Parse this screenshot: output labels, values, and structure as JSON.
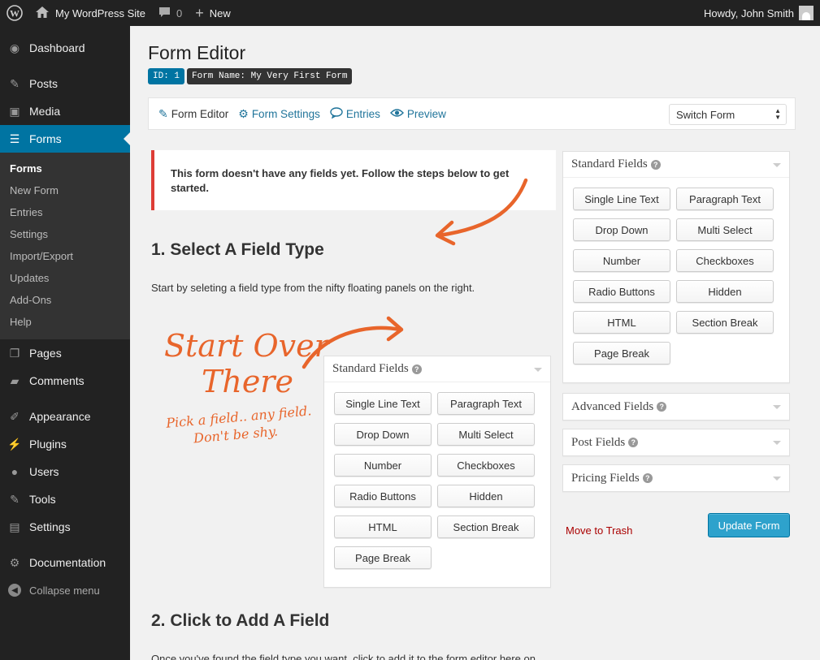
{
  "adminbar": {
    "site_name": "My WordPress Site",
    "comments_count": "0",
    "new_label": "New",
    "greeting": "Howdy, John Smith"
  },
  "sidebar": {
    "dashboard": "Dashboard",
    "posts": "Posts",
    "media": "Media",
    "forms": "Forms",
    "forms_sub": [
      "Forms",
      "New Form",
      "Entries",
      "Settings",
      "Import/Export",
      "Updates",
      "Add-Ons",
      "Help"
    ],
    "pages": "Pages",
    "comments": "Comments",
    "appearance": "Appearance",
    "plugins": "Plugins",
    "users": "Users",
    "tools": "Tools",
    "settings": "Settings",
    "documentation": "Documentation",
    "collapse": "Collapse menu"
  },
  "page": {
    "title": "Form Editor",
    "id_badge": "ID: 1",
    "name_badge": "Form Name: My Very First Form"
  },
  "toolbar": {
    "form_editor": "Form Editor",
    "form_settings": "Form Settings",
    "entries": "Entries",
    "preview": "Preview",
    "switch_form": "Switch Form"
  },
  "notice": "This form doesn't have any fields yet. Follow the steps below to get started.",
  "steps": {
    "step1_title": "1. Select A Field Type",
    "step1_text": "Start by seleting a field type from the nifty floating panels on the right.",
    "step2_title": "2. Click to Add A Field",
    "step2_text": "Once you've found the field type you want, click to add it to the form editor here on"
  },
  "handwriting": {
    "line1": "Start Over",
    "line2": "There",
    "line3": "Pick a field.. any field.",
    "line4": "Don't be shy."
  },
  "panels": {
    "standard": "Standard Fields",
    "advanced": "Advanced Fields",
    "post": "Post Fields",
    "pricing": "Pricing Fields"
  },
  "standard_fields": [
    "Single Line Text",
    "Paragraph Text",
    "Drop Down",
    "Multi Select",
    "Number",
    "Checkboxes",
    "Radio Buttons",
    "Hidden",
    "HTML",
    "Section Break",
    "Page Break"
  ],
  "actions": {
    "trash": "Move to Trash",
    "update": "Update Form"
  }
}
